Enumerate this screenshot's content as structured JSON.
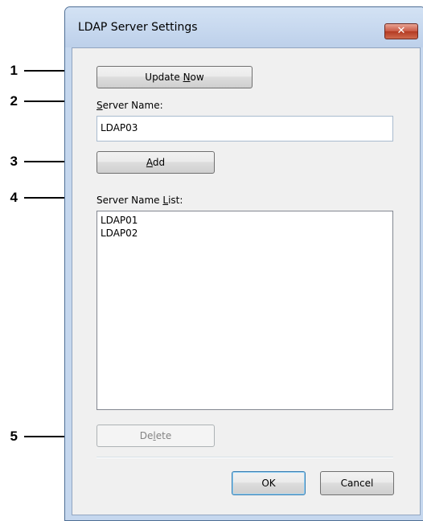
{
  "callouts": [
    "1",
    "2",
    "3",
    "4",
    "5"
  ],
  "dialog": {
    "title": "LDAP Server Settings",
    "close_glyph": "✕",
    "update_now": {
      "before": "Update ",
      "mnemonic": "N",
      "after": "ow"
    },
    "server_name_label": {
      "before": "",
      "mnemonic": "S",
      "after": "erver Name:"
    },
    "server_name_value": "LDAP03",
    "add": {
      "before": "",
      "mnemonic": "A",
      "after": "dd"
    },
    "server_list_label": {
      "before": "Server Name ",
      "mnemonic": "L",
      "after": "ist:"
    },
    "server_list": [
      "LDAP01",
      "LDAP02"
    ],
    "delete": {
      "before": "De",
      "mnemonic": "l",
      "after": "ete"
    },
    "ok_label": "OK",
    "cancel_label": "Cancel"
  },
  "colors": {
    "frame": "#c5d7ee",
    "client": "#f0f0f0",
    "close_button": "#c95a45"
  },
  "icons": [
    "close-icon"
  ]
}
